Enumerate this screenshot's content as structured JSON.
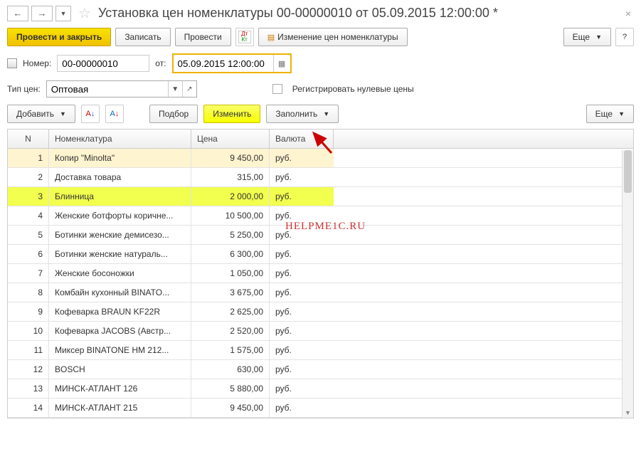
{
  "header": {
    "title": "Установка цен номенклатуры 00-00000010 от 05.09.2015 12:00:00 *"
  },
  "toolbar": {
    "post_close": "Провести и закрыть",
    "save": "Записать",
    "post": "Провести",
    "price_change": "Изменение цен номенклатуры",
    "more": "Еще"
  },
  "fields": {
    "number_label": "Номер:",
    "number_value": "00-00000010",
    "from_label": "от:",
    "date_value": "05.09.2015 12:00:00",
    "price_type_label": "Тип цен:",
    "price_type_value": "Оптовая",
    "register_zero_label": "Регистрировать нулевые цены"
  },
  "row_toolbar": {
    "add": "Добавить",
    "select": "Подбор",
    "change": "Изменить",
    "fill": "Заполнить",
    "more": "Еще"
  },
  "table": {
    "headers": {
      "n": "N",
      "nom": "Номенклатура",
      "price": "Цена",
      "cur": "Валюта"
    },
    "rows": [
      {
        "n": "1",
        "nom": "Копир \"Minolta\"",
        "price": "9 450,00",
        "cur": "руб.",
        "state": "selected"
      },
      {
        "n": "2",
        "nom": "Доставка товара",
        "price": "315,00",
        "cur": "руб.",
        "state": ""
      },
      {
        "n": "3",
        "nom": "Блинница",
        "price": "2 000,00",
        "cur": "руб.",
        "state": "yellow"
      },
      {
        "n": "4",
        "nom": "Женские ботфорты коричне...",
        "price": "10 500,00",
        "cur": "руб.",
        "state": ""
      },
      {
        "n": "5",
        "nom": "Ботинки женские демисезо...",
        "price": "5 250,00",
        "cur": "руб.",
        "state": ""
      },
      {
        "n": "6",
        "nom": "Ботинки женские натураль...",
        "price": "6 300,00",
        "cur": "руб.",
        "state": ""
      },
      {
        "n": "7",
        "nom": "Женские босоножки",
        "price": "1 050,00",
        "cur": "руб.",
        "state": ""
      },
      {
        "n": "8",
        "nom": "Комбайн кухонный BINATO...",
        "price": "3 675,00",
        "cur": "руб.",
        "state": ""
      },
      {
        "n": "9",
        "nom": "Кофеварка BRAUN KF22R",
        "price": "2 625,00",
        "cur": "руб.",
        "state": ""
      },
      {
        "n": "10",
        "nom": "Кофеварка JACOBS (Австр...",
        "price": "2 520,00",
        "cur": "руб.",
        "state": ""
      },
      {
        "n": "11",
        "nom": "Миксер BINATONE HM 212...",
        "price": "1 575,00",
        "cur": "руб.",
        "state": ""
      },
      {
        "n": "12",
        "nom": "BOSCH",
        "price": "630,00",
        "cur": "руб.",
        "state": ""
      },
      {
        "n": "13",
        "nom": "МИНСК-АТЛАНТ 126",
        "price": "5 880,00",
        "cur": "руб.",
        "state": ""
      },
      {
        "n": "14",
        "nom": "МИНСК-АТЛАНТ 215",
        "price": "9 450,00",
        "cur": "руб.",
        "state": ""
      }
    ]
  },
  "watermark": "HELPME1C.RU"
}
